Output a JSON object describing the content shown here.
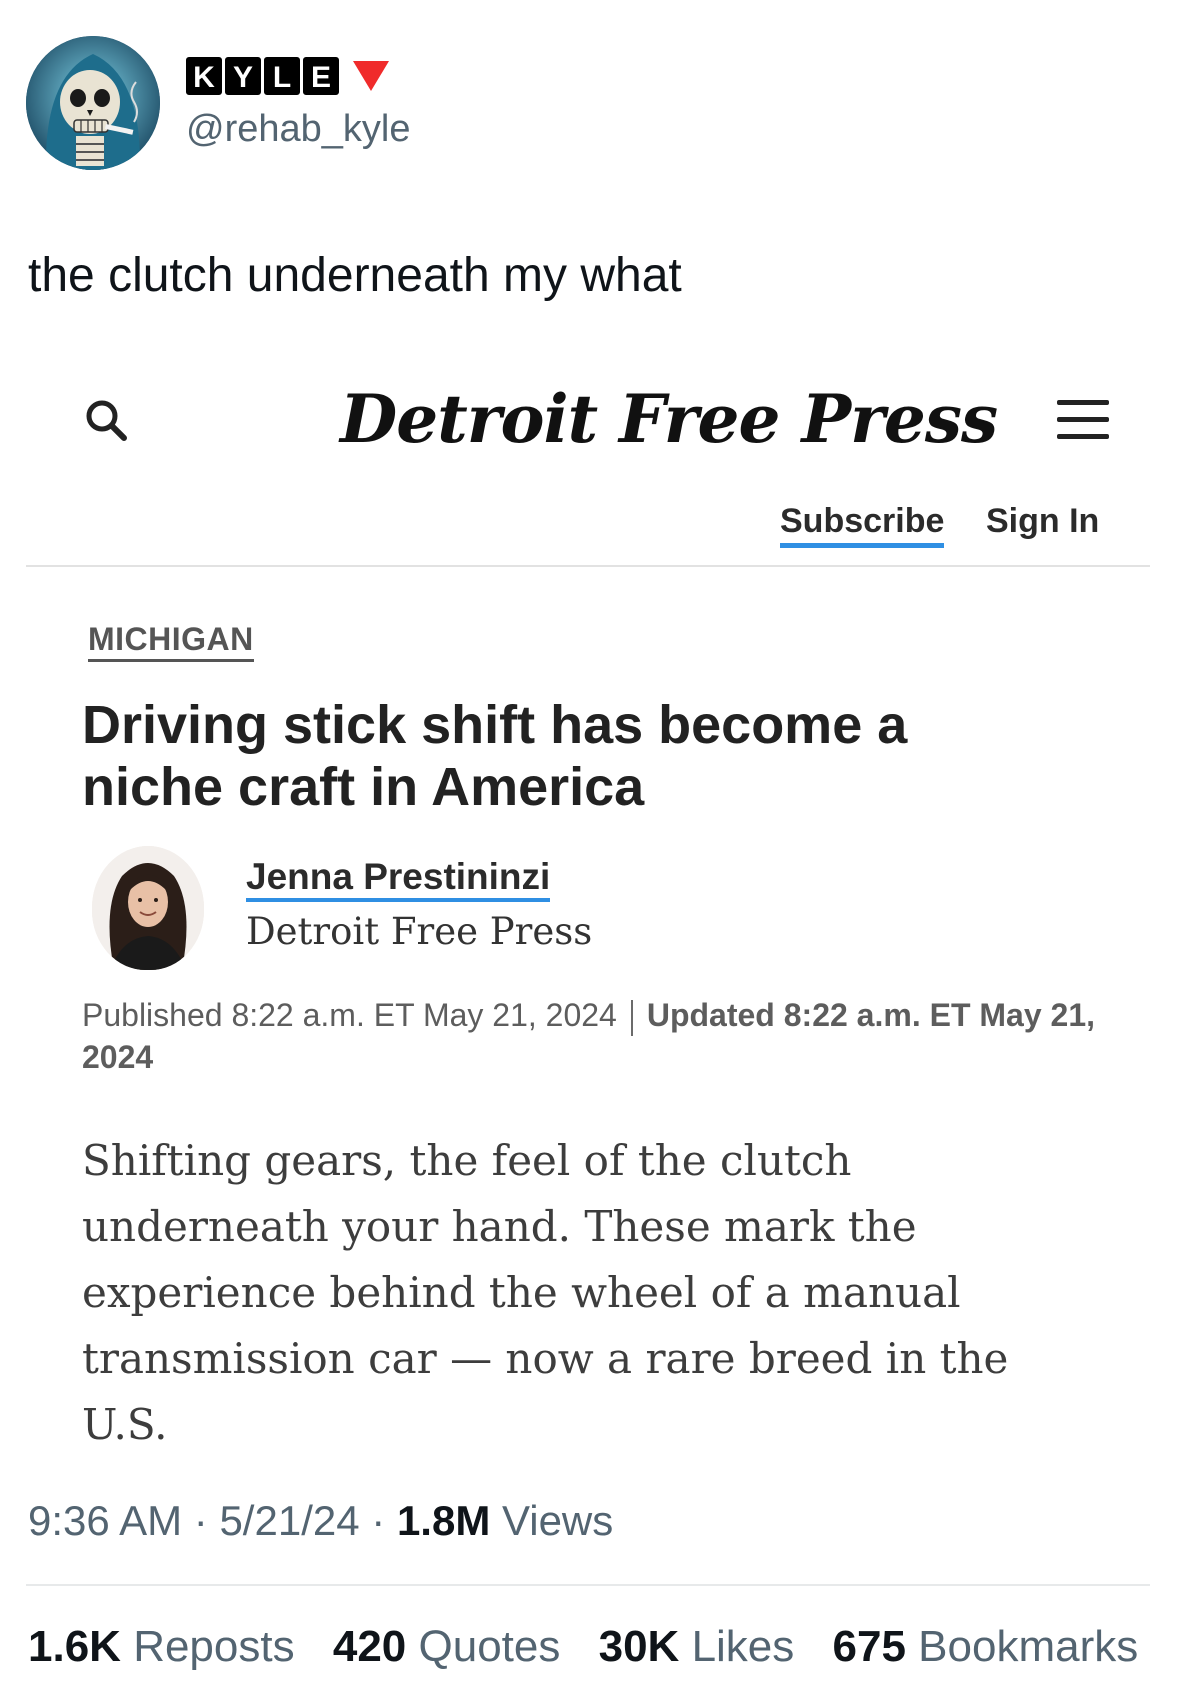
{
  "tweet": {
    "display_name_letters": [
      "K",
      "Y",
      "L",
      "E"
    ],
    "handle": "@rehab_kyle",
    "text": "the clutch underneath my what",
    "time": "9:36 AM",
    "date": "5/21/24",
    "views_count": "1.8M",
    "views_label": "Views",
    "separator": "·",
    "stats": [
      {
        "count": "1.6K",
        "label": "Reposts"
      },
      {
        "count": "420",
        "label": "Quotes"
      },
      {
        "count": "30K",
        "label": "Likes"
      },
      {
        "count": "675",
        "label": "Bookmarks"
      }
    ]
  },
  "article": {
    "masthead": "Detroit Free Press",
    "subscribe": "Subscribe",
    "sign_in": "Sign In",
    "section": "MICHIGAN",
    "headline": "Driving stick shift has become a niche craft in America",
    "author": "Jenna Prestininzi",
    "author_org": "Detroit Free Press",
    "published": "Published 8:22 a.m. ET May 21, 2024",
    "updated": "Updated 8:22 a.m. ET May 21, 2024",
    "lede": "Shifting gears, the feel of the clutch underneath your hand. These mark the experience behind the wheel of a manual transmission car — now a rare breed in the U.S."
  },
  "colors": {
    "accent_blue": "#2f8fe3",
    "muted_text": "#536471",
    "name_triangle": "#f02b2b"
  }
}
